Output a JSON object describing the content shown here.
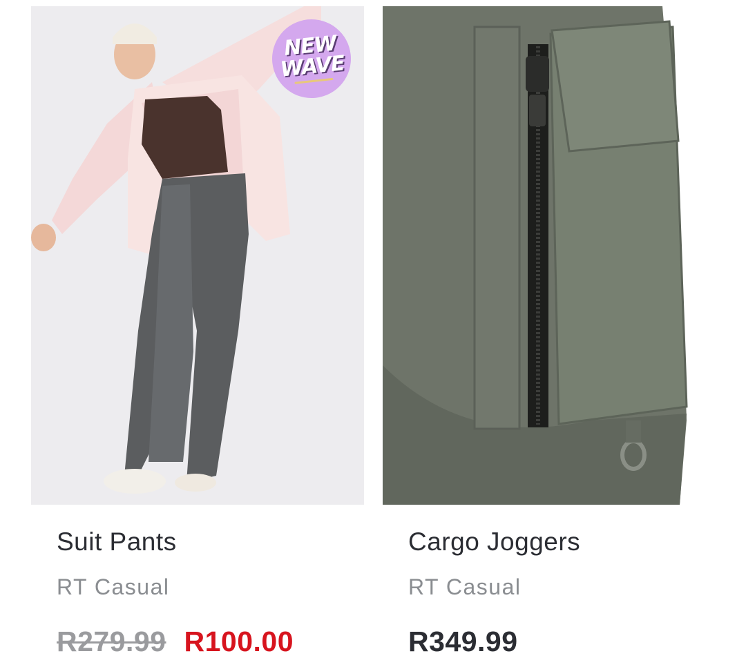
{
  "products": [
    {
      "title": "Suit Pants",
      "brand": "RT Casual",
      "price_original": "R279.99",
      "price_sale": "R100.00",
      "badge": {
        "line1": "NEW",
        "line2": "WAVE",
        "color": "#d4a8ee"
      },
      "sale_color": "#d7141e"
    },
    {
      "title": "Cargo Joggers",
      "brand": "RT Casual",
      "price": "R349.99"
    }
  ]
}
